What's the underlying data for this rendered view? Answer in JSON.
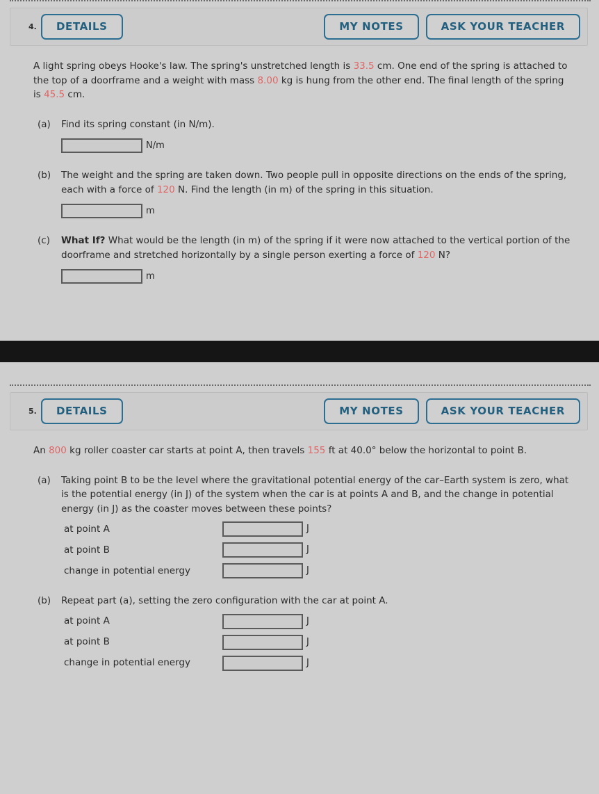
{
  "theme": {
    "page_bg": "#cfcfcf",
    "card_bg": "#cccccc",
    "button_border": "#2c6e91",
    "button_text": "#23607f",
    "highlight_red": "#e06666",
    "input_border": "#5a5a5a",
    "divider_black": "#151515"
  },
  "problems": [
    {
      "number": "4.",
      "buttons": {
        "details": "DETAILS",
        "my_notes": "MY NOTES",
        "ask_teacher": "ASK YOUR TEACHER"
      },
      "stem": {
        "t1": "A light spring obeys Hooke's law. The spring's unstretched length is ",
        "v1": "33.5",
        "t2": " cm. One end of the spring is attached to the top of a doorframe and a weight with mass ",
        "v2": "8.00",
        "t3": " kg is hung from the other end. The final length of the spring is ",
        "v3": "45.5",
        "t4": " cm."
      },
      "parts": [
        {
          "label": "(a)",
          "text": "Find its spring constant (in N/m).",
          "unit": "N/m"
        },
        {
          "label": "(b)",
          "t1": "The weight and the spring are taken down. Two people pull in opposite directions on the ends of the spring, each with a force of ",
          "v1": "120",
          "t2": " N. Find the length (in m) of the spring in this situation.",
          "unit": "m"
        },
        {
          "label": "(c)",
          "bold": "What If?",
          "t1": " What would be the length (in m) of the spring if it were now attached to the vertical portion of the doorframe and stretched horizontally by a single person exerting a force of ",
          "v1": "120",
          "t2": " N?",
          "unit": "m"
        }
      ]
    },
    {
      "number": "5.",
      "buttons": {
        "details": "DETAILS",
        "my_notes": "MY NOTES",
        "ask_teacher": "ASK YOUR TEACHER"
      },
      "stem": {
        "t1": "An ",
        "v1": "800",
        "t2": " kg roller coaster car starts at point A, then travels ",
        "v2": "155",
        "t3": " ft at 40.0° below the horizontal to point B."
      },
      "parts": [
        {
          "label": "(a)",
          "text": "Taking point B to be the level where the gravitational potential energy of the car–Earth system is zero, what is the potential energy (in J) of the system when the car is at points A and B, and the change in potential energy (in J) as the coaster moves between these points?",
          "rows": [
            {
              "label": "at point A",
              "unit": "J"
            },
            {
              "label": "at point B",
              "unit": "J"
            },
            {
              "label": "change in potential energy",
              "unit": "J"
            }
          ]
        },
        {
          "label": "(b)",
          "text": "Repeat part (a), setting the zero configuration with the car at point A.",
          "rows": [
            {
              "label": "at point A",
              "unit": "J"
            },
            {
              "label": "at point B",
              "unit": "J"
            },
            {
              "label": "change in potential energy",
              "unit": "J"
            }
          ]
        }
      ]
    }
  ]
}
